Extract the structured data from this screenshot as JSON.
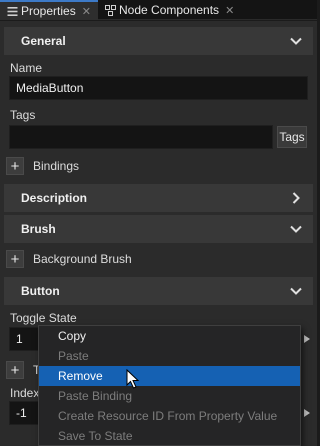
{
  "tabs": [
    {
      "label": "Properties",
      "icon": "properties-icon",
      "active": true
    },
    {
      "label": "Node Components",
      "icon": "node-components-icon",
      "active": false
    }
  ],
  "sections": {
    "general": "General",
    "description": "Description",
    "brush": "Brush",
    "button": "Button"
  },
  "fields": {
    "name_label": "Name",
    "name_value": "MediaButton",
    "tags_label": "Tags",
    "tags_value": "",
    "tags_button": "Tags",
    "toggle_state_label": "Toggle State",
    "toggle_state_value": "1",
    "index_label": "Index",
    "index_value": "-1",
    "hidden_plus_label_fragment": "T"
  },
  "add_rows": {
    "bindings": "Bindings",
    "background_brush": "Background Brush"
  },
  "context_menu": {
    "items": [
      {
        "label": "Copy",
        "enabled": true,
        "highlighted": false
      },
      {
        "label": "Paste",
        "enabled": false,
        "highlighted": false
      },
      {
        "label": "Remove",
        "enabled": true,
        "highlighted": true
      },
      {
        "label": "Paste Binding",
        "enabled": false,
        "highlighted": false
      },
      {
        "label": "Create Resource ID From Property Value",
        "enabled": false,
        "highlighted": false
      },
      {
        "label": "Save To State",
        "enabled": false,
        "highlighted": false
      }
    ]
  },
  "colors": {
    "accent": "#3d7ac7",
    "highlight": "#1561b3",
    "panel": "#2b2b2b",
    "section": "#383838"
  }
}
